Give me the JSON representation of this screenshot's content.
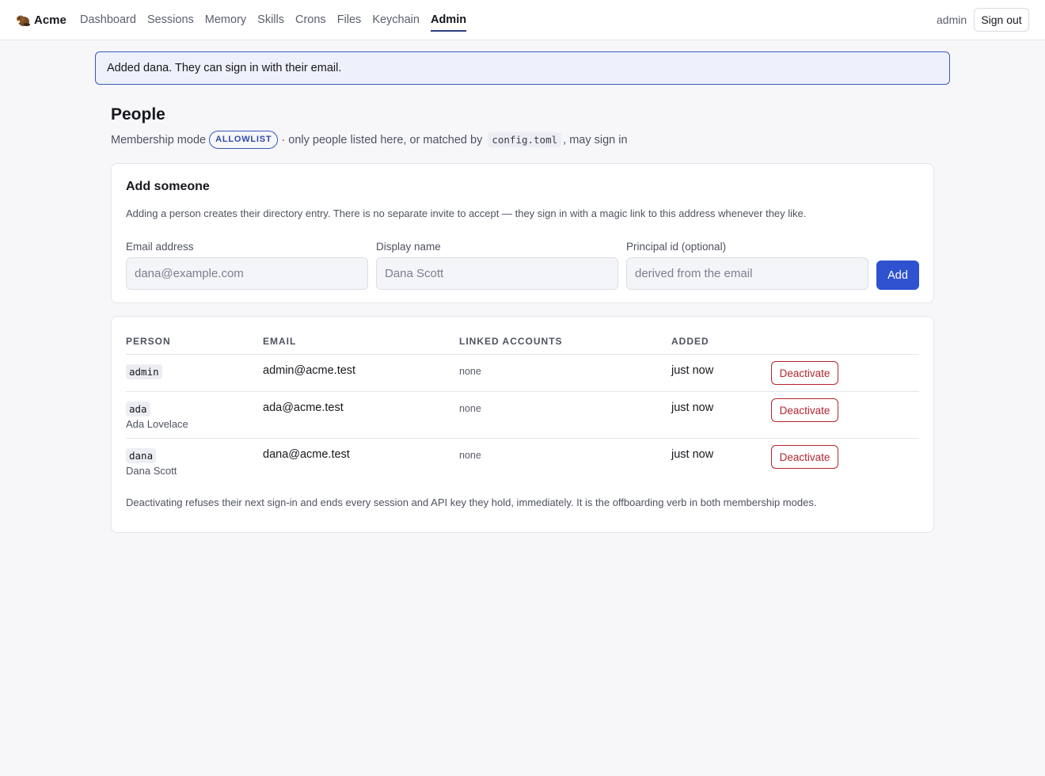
{
  "app": {
    "name": "Acme",
    "icon": "beaver-icon"
  },
  "nav": {
    "items": [
      "Dashboard",
      "Sessions",
      "Memory",
      "Skills",
      "Crons",
      "Files",
      "Keychain",
      "Admin"
    ],
    "active": "Admin"
  },
  "user": {
    "name": "admin",
    "signout_label": "Sign out"
  },
  "flash": "Added dana. They can sign in with their email.",
  "page": {
    "title": "People",
    "mode_prefix": "Membership mode",
    "mode_badge": "ALLOWLIST",
    "mode_middle": "· only people listed here, or matched by",
    "mode_code": "config.toml",
    "mode_suffix": ", may sign in"
  },
  "add_form": {
    "title": "Add someone",
    "description": "Adding a person creates their directory entry. There is no separate invite to accept — they sign in with a magic link to this address whenever they like.",
    "email_label": "Email address",
    "email_placeholder": "dana@example.com",
    "name_label": "Display name",
    "name_placeholder": "Dana Scott",
    "principal_label": "Principal id (optional)",
    "principal_placeholder": "derived from the email",
    "submit_label": "Add"
  },
  "people_table": {
    "columns": [
      "PERSON",
      "EMAIL",
      "LINKED ACCOUNTS",
      "ADDED"
    ],
    "rows": [
      {
        "handle": "admin",
        "full_name": "",
        "email": "admin@acme.test",
        "linked": "none",
        "added": "just now",
        "action": "Deactivate"
      },
      {
        "handle": "ada",
        "full_name": "Ada Lovelace",
        "email": "ada@acme.test",
        "linked": "none",
        "added": "just now",
        "action": "Deactivate"
      },
      {
        "handle": "dana",
        "full_name": "Dana Scott",
        "email": "dana@acme.test",
        "linked": "none",
        "added": "just now",
        "action": "Deactivate"
      }
    ],
    "footnote": "Deactivating refuses their next sign-in and ends every session and API key they hold, immediately. It is the offboarding verb in both membership modes."
  },
  "colors": {
    "accent": "#2f52d0",
    "danger": "#b3262f",
    "flash_border": "#3b57b8"
  }
}
